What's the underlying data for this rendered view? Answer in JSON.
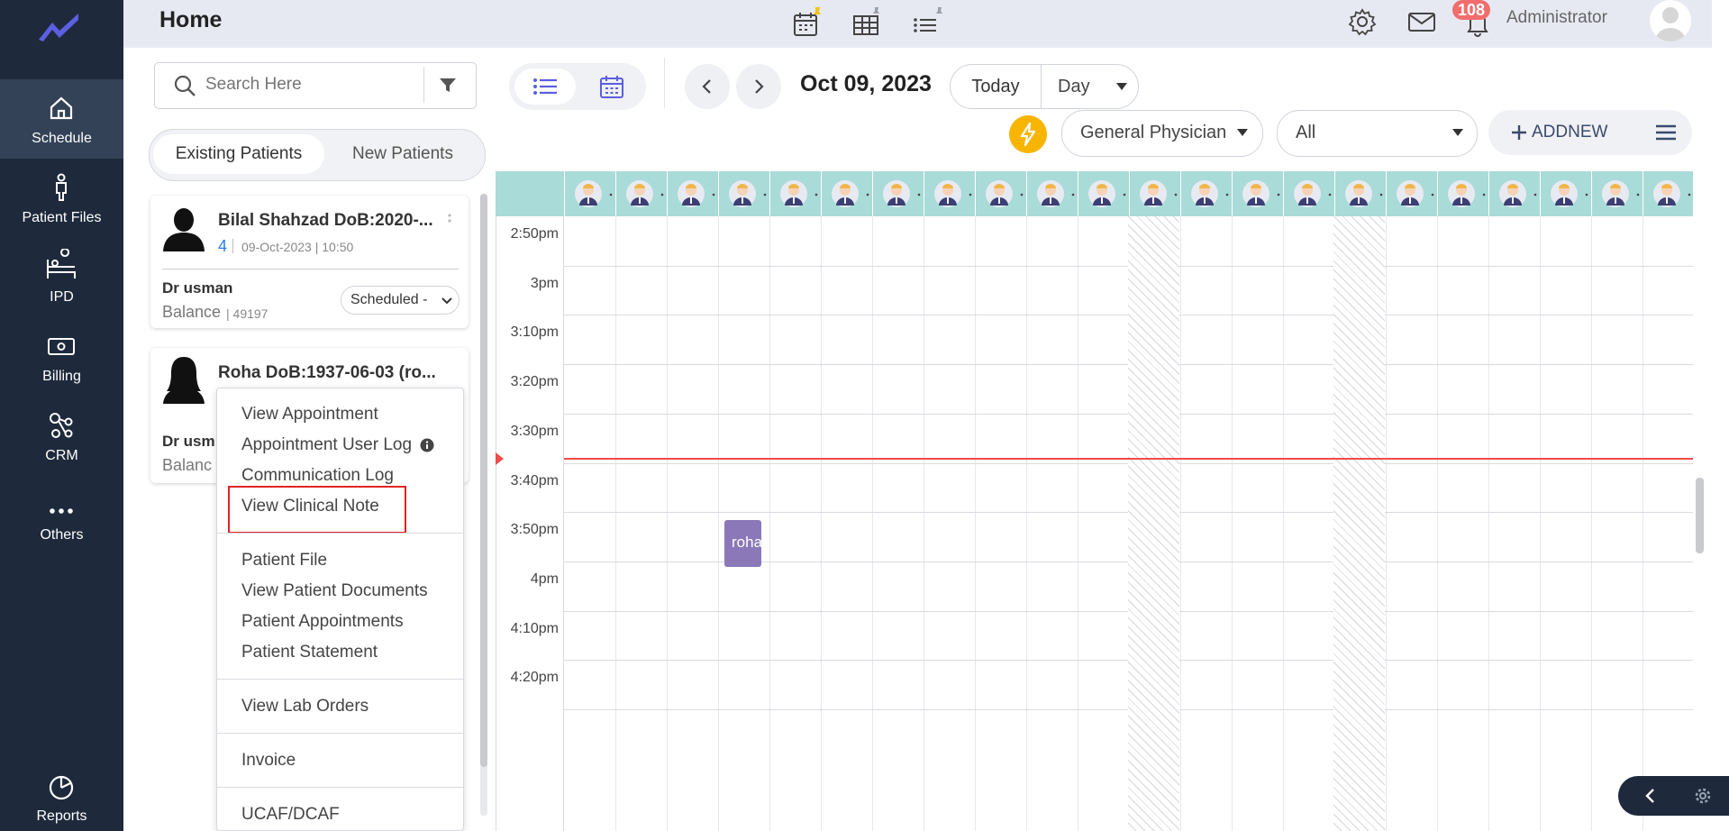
{
  "header": {
    "title": "Home",
    "notification_count": "108",
    "user_name": "Administrator"
  },
  "sidebar": {
    "items": [
      {
        "label": "Schedule",
        "icon": "home-icon"
      },
      {
        "label": "Patient Files",
        "icon": "person-icon"
      },
      {
        "label": "IPD",
        "icon": "bed-icon"
      },
      {
        "label": "Billing",
        "icon": "money-icon"
      },
      {
        "label": "CRM",
        "icon": "network-icon"
      },
      {
        "label": "Others",
        "icon": "more-dots-icon"
      },
      {
        "label": "Reports",
        "icon": "reports-icon"
      }
    ]
  },
  "search": {
    "placeholder": "Search Here"
  },
  "patient_tabs": [
    "Existing Patients",
    "New Patients"
  ],
  "patients": [
    {
      "name": "Bilal Shahzad DoB:2020-...",
      "count": "4",
      "datetime": "09-Oct-2023 | 10:50",
      "doctor": "Dr usman",
      "balance_label": "Balance",
      "balance": "| 49197",
      "status": "Scheduled -"
    },
    {
      "name": "Roha DoB:1937-06-03 (ro...",
      "doctor": "Dr usm",
      "balance_label": "Balanc"
    }
  ],
  "context_menu": {
    "items": [
      "View Appointment",
      "Appointment User Log",
      "Communication Log",
      "View Clinical Note",
      "Patient File",
      "View Patient Documents",
      "Patient Appointments",
      "Patient Statement",
      "View Lab Orders",
      "Invoice",
      "UCAF/DCAF"
    ],
    "highlighted": "View Clinical Note"
  },
  "toolbar": {
    "date": "Oct 09, 2023",
    "today_label": "Today",
    "view_mode": "Day",
    "specialty": "General Physician",
    "filter": "All",
    "add_new_label": "ADDNEW"
  },
  "calendar": {
    "time_slots": [
      "2:50pm",
      "3pm",
      "3:10pm",
      "3:20pm",
      "3:30pm",
      "3:40pm",
      "3:50pm",
      "4pm",
      "4:10pm",
      "4:20pm"
    ],
    "appointment_label": "roha",
    "resource_count": 22
  },
  "colors": {
    "sidebar": "#1e2a3c",
    "accent": "#5b5fe0",
    "resource_header": "#a9dbd9",
    "appointment": "#8b78b8",
    "badge": "#f26d6d",
    "now_line": "#ef4b4b",
    "highlight_box": "#e02424"
  }
}
